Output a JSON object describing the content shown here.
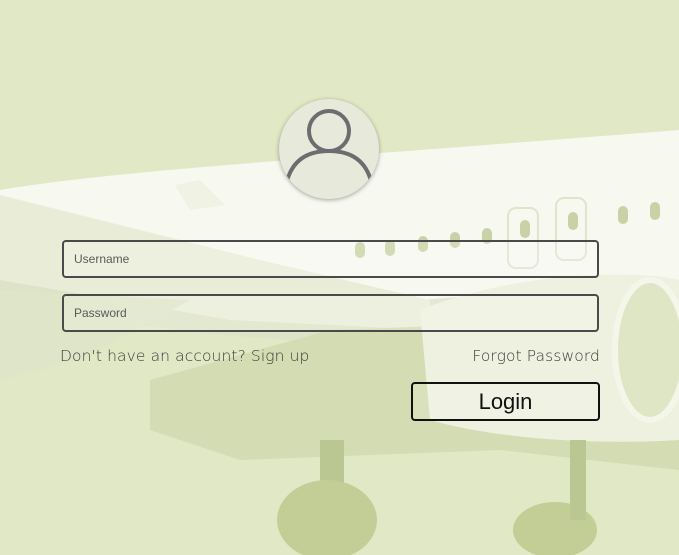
{
  "form": {
    "username_placeholder": "Username",
    "password_placeholder": "Password",
    "signup_link": "Don't have an account? Sign up",
    "forgot_link": "Forgot Password",
    "login_label": "Login"
  },
  "icons": {
    "avatar": "user-icon"
  },
  "colors": {
    "background": "#e1e8c5",
    "plane_tint": "#c8d29c",
    "border": "#4a4a4a"
  }
}
